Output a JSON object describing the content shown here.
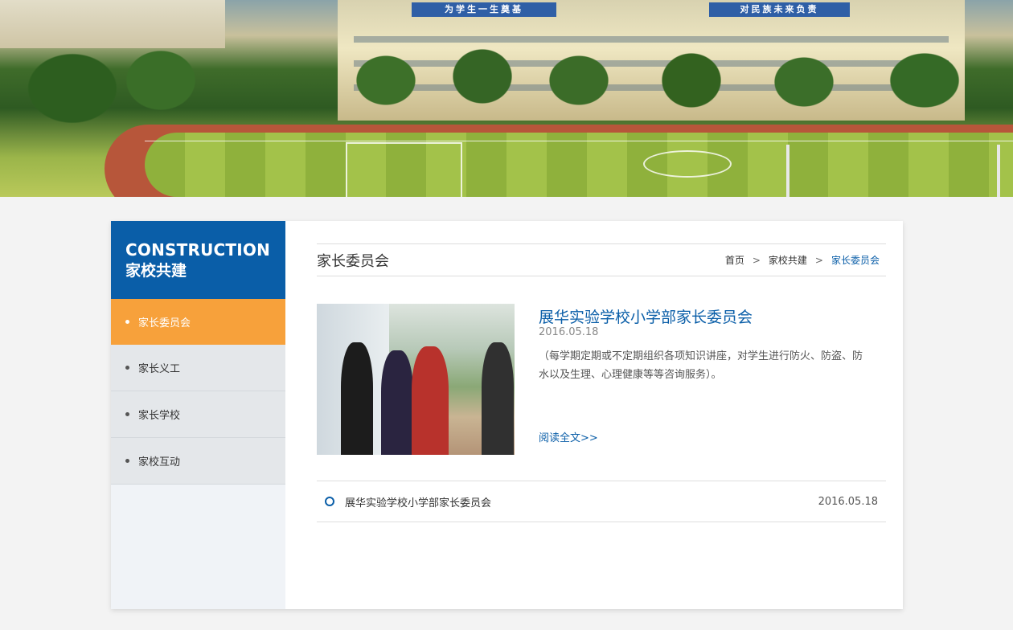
{
  "banner": {
    "sign_left": "为学生一生奠基",
    "sign_right": "对民族未来负责"
  },
  "sidebar": {
    "title_en": "CONSTRUCTION",
    "title_cn": "家校共建",
    "items": [
      {
        "label": "家长委员会",
        "active": true
      },
      {
        "label": "家长义工",
        "active": false
      },
      {
        "label": "家长学校",
        "active": false
      },
      {
        "label": "家校互动",
        "active": false
      }
    ]
  },
  "main": {
    "title": "家长委员会",
    "breadcrumb": [
      "首页",
      "家校共建",
      "家长委员会"
    ],
    "breadcrumb_sep": ">",
    "feature": {
      "title": "展华实验学校小学部家长委员会",
      "date": "2016.05.18",
      "description": "（每学期定期或不定期组织各项知识讲座，对学生进行防火、防盗、防水以及生理、心理健康等等咨询服务）。",
      "read_more": "阅读全文>>"
    },
    "list": [
      {
        "title": "展华实验学校小学部家长委员会",
        "date": "2016.05.18"
      }
    ]
  },
  "colors": {
    "brand_blue": "#0a5ea8",
    "active_orange": "#f7a13b"
  }
}
